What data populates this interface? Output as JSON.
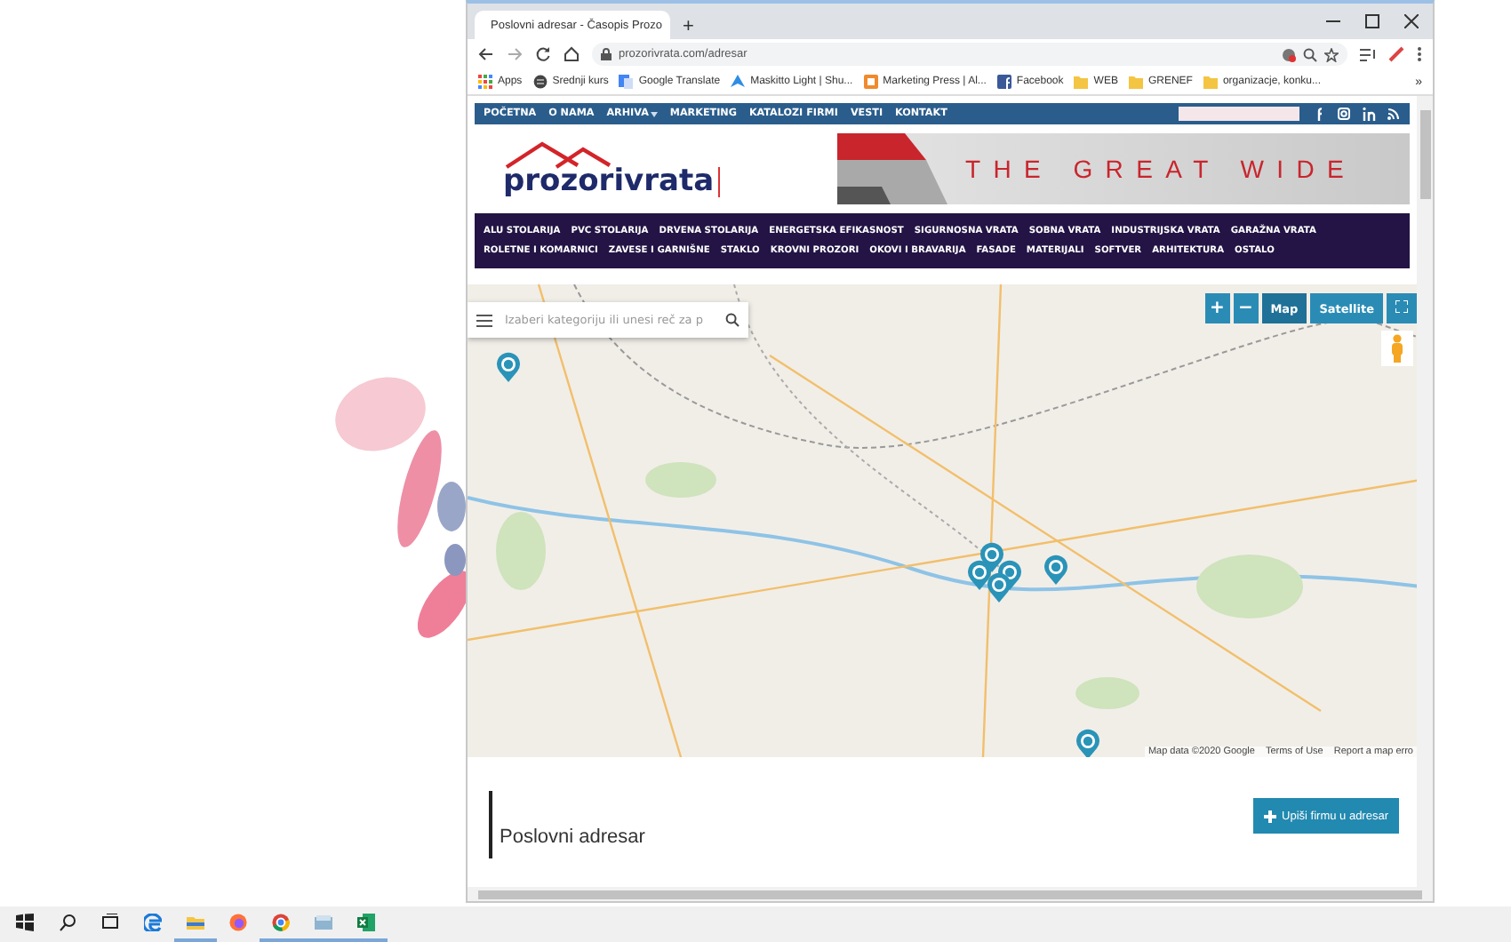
{
  "browser": {
    "tab": {
      "title": "Poslovni adresar - Časopis Prozo",
      "selected": true
    },
    "new_tab": "+",
    "url": "prozorivrata.com/adresar",
    "bookmarks": [
      {
        "kind": "apps",
        "label": "Apps"
      },
      {
        "kind": "globe",
        "label": "Srednji kurs"
      },
      {
        "kind": "translate",
        "label": "Google Translate"
      },
      {
        "kind": "arrow",
        "label": "Maskitto Light | Shu..."
      },
      {
        "kind": "press",
        "label": "Marketing Press | Al..."
      },
      {
        "kind": "facebook",
        "label": "Facebook"
      },
      {
        "kind": "folder",
        "label": "WEB"
      },
      {
        "kind": "folder",
        "label": "GRENEF"
      },
      {
        "kind": "folder",
        "label": "organizacje, konku..."
      }
    ],
    "more_bookmarks": "»"
  },
  "site": {
    "top_nav": [
      {
        "label": "POČETNA",
        "dropdown": false
      },
      {
        "label": "O NAMA",
        "dropdown": false
      },
      {
        "label": "ARHIVA",
        "dropdown": true
      },
      {
        "label": "MARKETING",
        "dropdown": false
      },
      {
        "label": "KATALOZI FIRMI",
        "dropdown": false
      },
      {
        "label": "VESTI",
        "dropdown": false
      },
      {
        "label": "KONTAKT",
        "dropdown": false
      }
    ],
    "social": [
      {
        "kind": "facebook"
      },
      {
        "kind": "instagram"
      },
      {
        "kind": "linkedin"
      },
      {
        "kind": "rss"
      }
    ],
    "logo": "prozorivrata",
    "banner": "THE GREAT WIDE",
    "categories": [
      "ALU STOLARIJA",
      "PVC STOLARIJA",
      "DRVENA STOLARIJA",
      "ENERGETSKA EFIKASNOST",
      "SIGURNOSNA VRATA",
      "SOBNA VRATA",
      "INDUSTRIJSKA VRATA",
      "GARAŽNA VRATA",
      "ROLETNE I KOMARNICI",
      "ZAVESE I GARNIŠNE",
      "STAKLO",
      "KROVNI PROZORI",
      "OKOVI I BRAVARIJA",
      "FASADE",
      "MATERIJALI",
      "SOFTVER",
      "ARHITEKTURA",
      "OSTALO"
    ],
    "map": {
      "search_placeholder": "Izaberi kategoriju ili unesi reč za p",
      "zoom_in": "+",
      "zoom_out": "−",
      "map_types": [
        {
          "label": "Map",
          "selected": true
        },
        {
          "label": "Satellite",
          "selected": false
        }
      ],
      "attribution": [
        "Map data ©2020 Google",
        "Terms of Use",
        "Report a map erro"
      ]
    },
    "heading": "Poslovni adresar",
    "add_button": "Upiši firmu u adresar"
  },
  "taskbar": [
    {
      "kind": "start",
      "running": false
    },
    {
      "kind": "search",
      "running": false
    },
    {
      "kind": "taskview",
      "running": false
    },
    {
      "kind": "edge",
      "running": false
    },
    {
      "kind": "explorer",
      "running": true
    },
    {
      "kind": "firefox",
      "running": false
    },
    {
      "kind": "chrome",
      "running": true
    },
    {
      "kind": "app",
      "running": true
    },
    {
      "kind": "excel",
      "running": true
    }
  ]
}
